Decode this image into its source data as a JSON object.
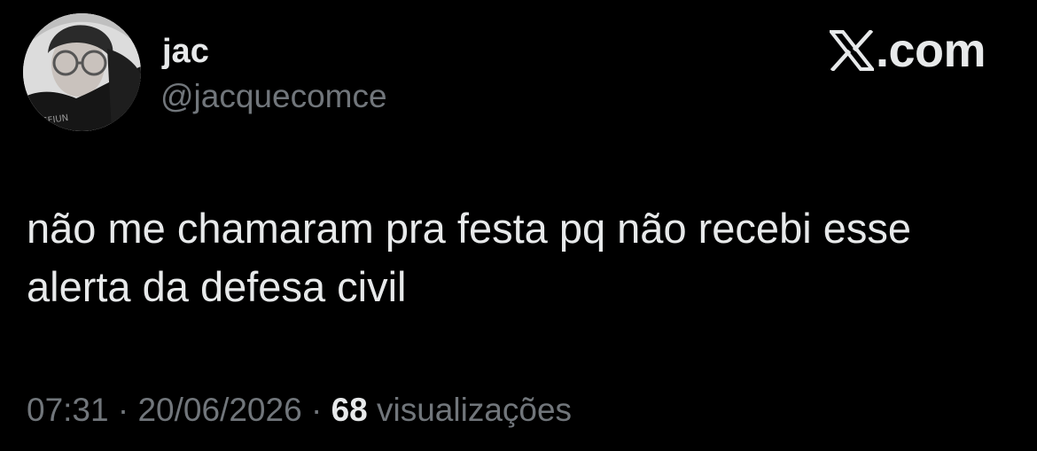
{
  "author": {
    "display_name": "jac",
    "handle": "@jacquecomce",
    "avatar_icon": "profile-photo"
  },
  "brand": {
    "logo_icon": "x-logo-icon",
    "suffix": ".com"
  },
  "tweet": {
    "lines": [
      "não me chamaram pra festa pq não recebi esse",
      "alerta da defesa civil"
    ]
  },
  "meta": {
    "time": "07:31",
    "separator": " · ",
    "date": "20/06/2026",
    "views_count": "68",
    "views_label": " visualizações"
  },
  "colors": {
    "background": "#000000",
    "primary_text": "#e7e9ea",
    "secondary_text": "#71767b"
  }
}
